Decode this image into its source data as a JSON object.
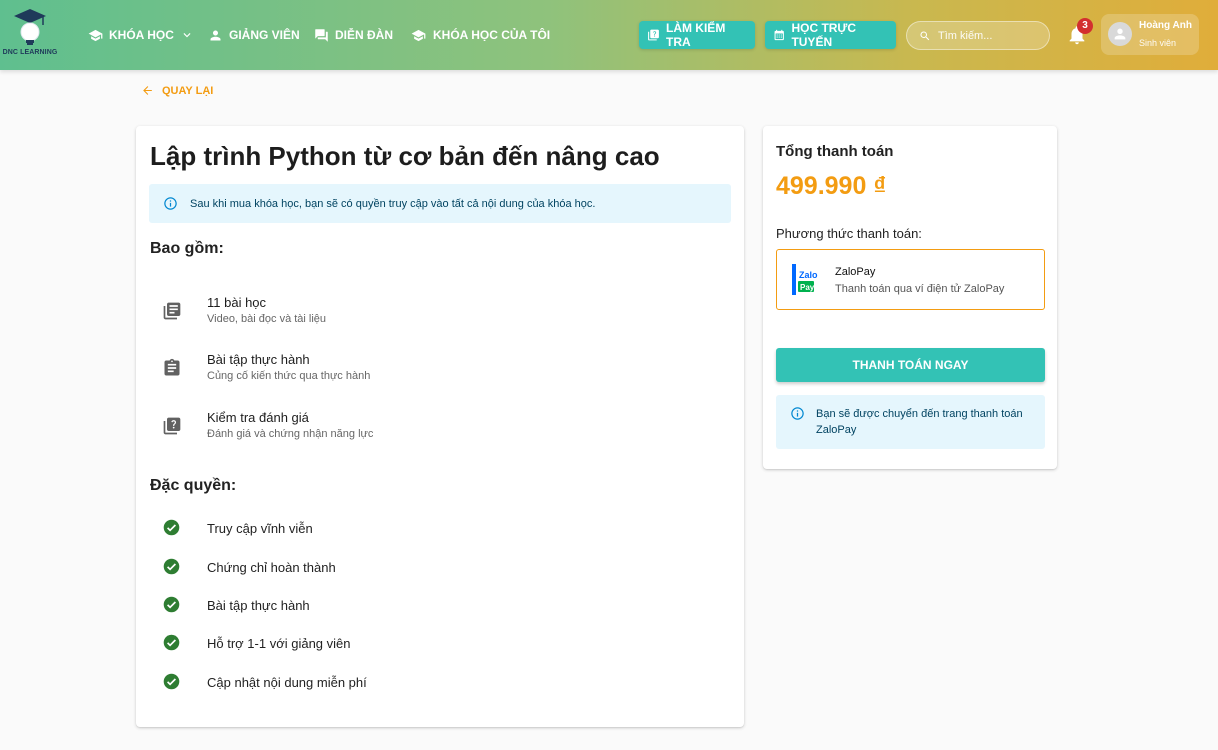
{
  "logo": {
    "text": "DNC LEARNING"
  },
  "nav": {
    "courses": "KHÓA HỌC",
    "instructors": "GIẢNG VIÊN",
    "forum": "DIỄN ĐÀN",
    "my_courses": "KHÓA HỌC CỦA TÔI"
  },
  "header_buttons": {
    "quiz": "LÀM KIỂM TRA",
    "online": "HỌC TRỰC TUYẾN"
  },
  "search": {
    "placeholder": "Tìm kiếm..."
  },
  "notifications": {
    "count": "3"
  },
  "user": {
    "name": "Hoàng Anh",
    "role": "Sinh viên"
  },
  "back": {
    "label": "QUAY LẠI"
  },
  "course": {
    "title": "Lập trình Python từ cơ bản đến nâng cao",
    "info": "Sau khi mua khóa học, bạn sẽ có quyền truy cập vào tất cả nội dung của khóa học.",
    "includes_title": "Bao gồm:",
    "includes": [
      {
        "icon": "library-books-icon",
        "title": "11 bài học",
        "subtitle": "Video, bài đọc và tài liệu"
      },
      {
        "icon": "assignment-icon",
        "title": "Bài tập thực hành",
        "subtitle": "Củng cố kiến thức qua thực hành"
      },
      {
        "icon": "quiz-icon",
        "title": "Kiểm tra đánh giá",
        "subtitle": "Đánh giá và chứng nhận năng lực"
      }
    ],
    "perks_title": "Đặc quyền:",
    "perks": [
      "Truy cập vĩnh viễn",
      "Chứng chỉ hoàn thành",
      "Bài tập thực hành",
      "Hỗ trợ 1-1 với giảng viên",
      "Cập nhật nội dung miễn phí"
    ]
  },
  "payment": {
    "total_label": "Tổng thanh toán",
    "total": "499.990 ₫",
    "method_label": "Phương thức thanh toán:",
    "method": {
      "name": "ZaloPay",
      "description": "Thanh toán qua ví điện tử ZaloPay",
      "logo_text_1": "Zalo",
      "logo_text_2": "Pay"
    },
    "pay_button": "THANH TOÁN NGAY",
    "redirect_info": "Bạn sẽ được chuyển đến trang thanh toán ZaloPay"
  },
  "colors": {
    "accent_teal": "#33c2b5",
    "accent_orange": "#f39c12",
    "check_green": "#2e7d32",
    "info_bg": "#e5f6fd"
  }
}
